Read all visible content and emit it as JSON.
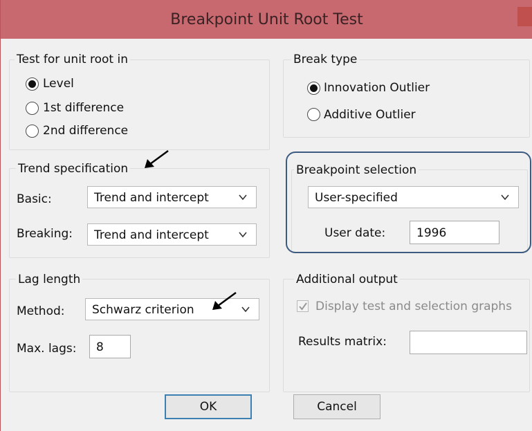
{
  "window": {
    "title": "Breakpoint Unit Root Test"
  },
  "unit_root": {
    "legend": "Test for unit root in",
    "options": [
      {
        "label": "Level",
        "checked": true
      },
      {
        "label": "1st difference",
        "checked": false
      },
      {
        "label": "2nd difference",
        "checked": false
      }
    ]
  },
  "break_type": {
    "legend": "Break type",
    "options": [
      {
        "label": "Innovation Outlier",
        "checked": true
      },
      {
        "label": "Additive Outlier",
        "checked": false
      }
    ]
  },
  "trend": {
    "legend": "Trend specification",
    "basic_label": "Basic:",
    "basic_value": "Trend and intercept",
    "breaking_label": "Breaking:",
    "breaking_value": "Trend and intercept"
  },
  "breakpoint": {
    "legend": "Breakpoint selection",
    "method_value": "User-specified",
    "user_date_label": "User date:",
    "user_date_value": "1996"
  },
  "lag": {
    "legend": "Lag length",
    "method_label": "Method:",
    "method_value": "Schwarz criterion",
    "max_lags_label": "Max. lags:",
    "max_lags_value": "8"
  },
  "additional": {
    "legend": "Additional output",
    "display_graphs_label": "Display test and selection graphs",
    "display_graphs_checked": true,
    "results_matrix_label": "Results matrix:",
    "results_matrix_value": ""
  },
  "buttons": {
    "ok": "OK",
    "cancel": "Cancel"
  },
  "icons": {
    "dropdown": "chevron-down-icon",
    "annotation": "arrow-icon",
    "check": "checkmark-icon"
  },
  "colors": {
    "titlebar": "#c8686f",
    "highlight": "#3d5a80",
    "default_button_border": "#3c7fb1"
  }
}
